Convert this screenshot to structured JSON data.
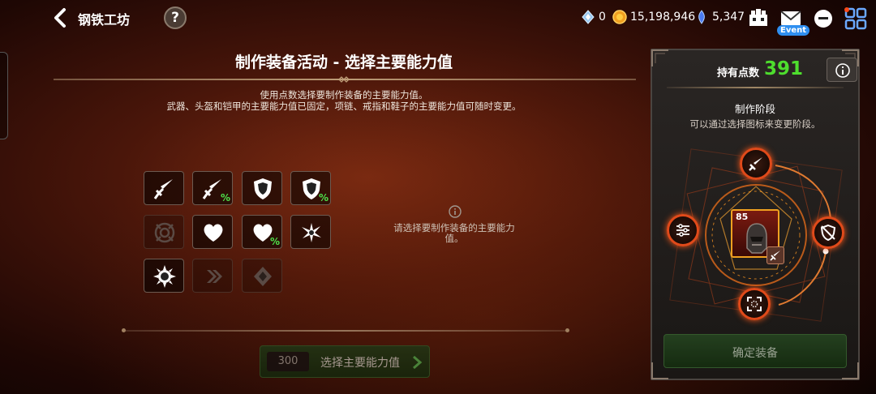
{
  "header": {
    "title": "钢铁工坊",
    "help": "?",
    "resources": [
      {
        "icon": "crystal-icon",
        "value": "0"
      },
      {
        "icon": "gold-coin-icon",
        "value": "15,198,946"
      },
      {
        "icon": "blue-gem-icon",
        "value": "5,347"
      }
    ],
    "event_badge": "Event"
  },
  "main": {
    "title": "制作装备活动 - 选择主要能力值",
    "desc_line1": "使用点数选择要制作装备的主要能力值。",
    "desc_line2": "武器、头盔和铠甲的主要能力值已固定，项链、戒指和鞋子的主要能力值可随时变更。",
    "percent": "%",
    "hint_text": "请选择要制作装备的主要能力值。",
    "select_cost": "300",
    "select_label": "选择主要能力值"
  },
  "stats": [
    {
      "name": "attack-stat",
      "icon": "sword-icon",
      "pct": false,
      "enabled": true
    },
    {
      "name": "attack-percent-stat",
      "icon": "sword-icon",
      "pct": true,
      "enabled": true
    },
    {
      "name": "defense-stat",
      "icon": "shield-icon",
      "pct": false,
      "enabled": true
    },
    {
      "name": "defense-percent-stat",
      "icon": "shield-icon",
      "pct": true,
      "enabled": true
    },
    {
      "name": "accuracy-stat",
      "icon": "target-icon",
      "pct": false,
      "enabled": false
    },
    {
      "name": "health-stat",
      "icon": "heart-icon",
      "pct": false,
      "enabled": true
    },
    {
      "name": "health-percent-stat",
      "icon": "heart-icon",
      "pct": true,
      "enabled": true
    },
    {
      "name": "crit-stat",
      "icon": "burst-icon",
      "pct": false,
      "enabled": true
    },
    {
      "name": "crit-damage-stat",
      "icon": "spiked-ring-icon",
      "pct": false,
      "enabled": true
    },
    {
      "name": "speed-stat",
      "icon": "double-arrow-icon",
      "pct": false,
      "enabled": false
    },
    {
      "name": "effect-stat",
      "icon": "crystal-diamond-icon",
      "pct": false,
      "enabled": false
    }
  ],
  "side": {
    "points_label": "持有点数",
    "points_value": "391",
    "stage_title": "制作阶段",
    "stage_desc": "可以通过选择图标来变更阶段。",
    "item_level": "85",
    "confirm_label": "确定装备"
  },
  "colors": {
    "accent_orange": "#e04a1a",
    "points_green": "#4ede2e",
    "percent_green": "#4ee04a"
  }
}
